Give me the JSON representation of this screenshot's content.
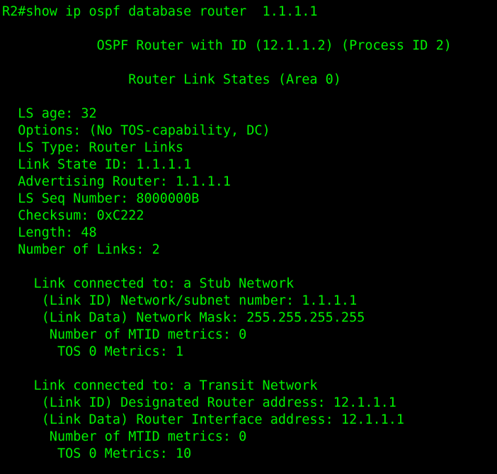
{
  "terminal": {
    "text_color": "#00f000",
    "background_color": "#000000",
    "lines": [
      "R2#show ip ospf database router  1.1.1.1",
      "",
      "            OSPF Router with ID (12.1.1.2) (Process ID 2)",
      "",
      "                Router Link States (Area 0)",
      "",
      "  LS age: 32",
      "  Options: (No TOS-capability, DC)",
      "  LS Type: Router Links",
      "  Link State ID: 1.1.1.1",
      "  Advertising Router: 1.1.1.1",
      "  LS Seq Number: 8000000B",
      "  Checksum: 0xC222",
      "  Length: 48",
      "  Number of Links: 2",
      "",
      "    Link connected to: a Stub Network",
      "     (Link ID) Network/subnet number: 1.1.1.1",
      "     (Link Data) Network Mask: 255.255.255.255",
      "      Number of MTID metrics: 0",
      "       TOS 0 Metrics: 1",
      "",
      "    Link connected to: a Transit Network",
      "     (Link ID) Designated Router address: 12.1.1.1",
      "     (Link Data) Router Interface address: 12.1.1.1",
      "      Number of MTID metrics: 0",
      "       TOS 0 Metrics: 10"
    ]
  }
}
